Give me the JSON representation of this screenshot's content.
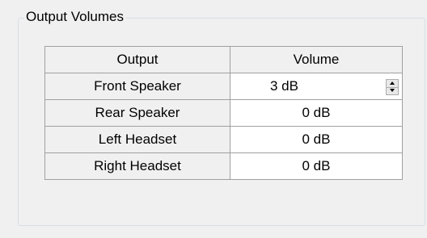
{
  "group": {
    "title": "Output Volumes"
  },
  "grid": {
    "columns": [
      "Output",
      "Volume"
    ],
    "rows": [
      {
        "output": "Front Speaker",
        "volume": "3 dB",
        "editing": true
      },
      {
        "output": "Rear Speaker",
        "volume": "0 dB"
      },
      {
        "output": "Left Headset",
        "volume": "0 dB"
      },
      {
        "output": "Right Headset",
        "volume": "0 dB"
      }
    ]
  },
  "icons": {
    "spin_up": "chevron-up-icon",
    "spin_down": "chevron-down-icon"
  },
  "colors": {
    "background": "#f0f0f0",
    "cell_background": "#ffffff",
    "grid_line": "#a0a0a0",
    "group_border": "#d5dfe5"
  }
}
